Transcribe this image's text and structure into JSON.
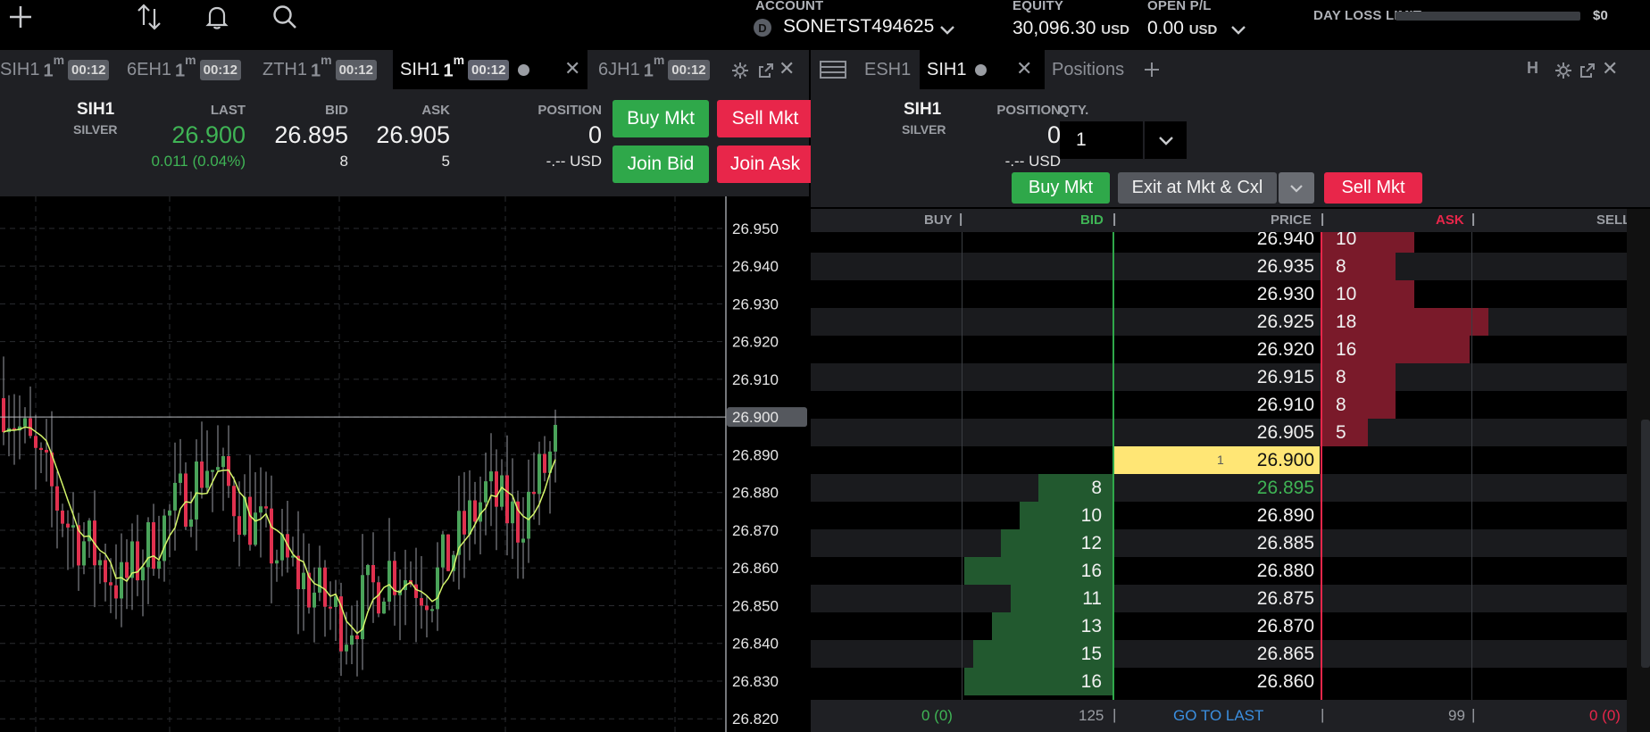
{
  "header": {
    "account_label": "ACCOUNT",
    "account_badge": "D",
    "account_value": "SONETST494625",
    "equity_label": "EQUITY",
    "equity_value": "30,096.30",
    "equity_currency": "USD",
    "openpl_label": "OPEN P/L",
    "openpl_value": "0.00",
    "openpl_currency": "USD",
    "dayloss_label": "DAY LOSS LIMIT",
    "dayloss_value": "$0"
  },
  "chart_tabs": [
    {
      "symbol": "SIH1",
      "tf": "1",
      "unit": "m",
      "timer": "00:12"
    },
    {
      "symbol": "6EH1",
      "tf": "1",
      "unit": "m",
      "timer": "00:12"
    },
    {
      "symbol": "ZTH1",
      "tf": "1",
      "unit": "m",
      "timer": "00:12"
    },
    {
      "symbol": "SIH1",
      "tf": "1",
      "unit": "m",
      "timer": "00:12"
    },
    {
      "symbol": "6JH1",
      "tf": "1",
      "unit": "m",
      "timer": "00:12"
    }
  ],
  "dom_tabs": [
    "ESH1",
    "SIH1",
    "Positions"
  ],
  "quote": {
    "symbol": "SIH1",
    "name": "SILVER",
    "last_label": "LAST",
    "last": "26.900",
    "change": "0.011 (0.04%)",
    "bid_label": "BID",
    "bid": "26.895",
    "bid_size": "8",
    "ask_label": "ASK",
    "ask": "26.905",
    "ask_size": "5",
    "position_label": "POSITION",
    "position": "0",
    "position_pl": "-.-- USD",
    "buy_mkt": "Buy Mkt",
    "sell_mkt": "Sell Mkt",
    "join_bid": "Join Bid",
    "join_ask": "Join Ask"
  },
  "dom": {
    "symbol": "SIH1",
    "name": "SILVER",
    "position_label": "POSITION",
    "position": "0",
    "position_pl": "-.-- USD",
    "qty_label": "QTY.",
    "qty": "1",
    "buy_mkt": "Buy Mkt",
    "exit_btn": "Exit at Mkt & Cxl",
    "sell_mkt": "Sell Mkt",
    "col_buy": "BUY",
    "col_bid": "BID",
    "col_price": "PRICE",
    "col_ask": "ASK",
    "col_sell": "SELL",
    "footer_buy": "0 (0)",
    "footer_bid_total": "125",
    "footer_goto": "GO TO LAST",
    "footer_ask_total": "99",
    "footer_sell": "0 (0)",
    "last_marker": "1",
    "rows": [
      {
        "price": "26.940",
        "ask": "10"
      },
      {
        "price": "26.935",
        "ask": "8"
      },
      {
        "price": "26.930",
        "ask": "10"
      },
      {
        "price": "26.925",
        "ask": "18"
      },
      {
        "price": "26.920",
        "ask": "16"
      },
      {
        "price": "26.915",
        "ask": "8"
      },
      {
        "price": "26.910",
        "ask": "8"
      },
      {
        "price": "26.905",
        "ask": "5"
      },
      {
        "price": "26.900",
        "last": true
      },
      {
        "price": "26.895",
        "bid": "8"
      },
      {
        "price": "26.890",
        "bid": "10"
      },
      {
        "price": "26.885",
        "bid": "12"
      },
      {
        "price": "26.880",
        "bid": "16"
      },
      {
        "price": "26.875",
        "bid": "11"
      },
      {
        "price": "26.870",
        "bid": "13"
      },
      {
        "price": "26.865",
        "bid": "15"
      },
      {
        "price": "26.860",
        "bid": "16"
      }
    ]
  },
  "chart_data": {
    "type": "candlestick",
    "price_axis": [
      "26.950",
      "26.940",
      "26.930",
      "26.920",
      "26.910",
      "26.900",
      "26.890",
      "26.880",
      "26.870",
      "26.860",
      "26.850",
      "26.840",
      "26.830",
      "26.820"
    ],
    "last_price_label": "26.900",
    "ylim": [
      26.8165,
      26.9585
    ],
    "last_price": 26.9,
    "grid": true,
    "colors": {
      "up": "#4aa35a",
      "down": "#e0314f",
      "ma": "#d4f56a"
    }
  },
  "colors": {
    "green": "#2fa84a",
    "red": "#e8264a",
    "last_highlight": "#ffe675",
    "bid_text": "#3fb455",
    "ask_text": "#e8264a",
    "goto_text": "#3b8fe0"
  }
}
